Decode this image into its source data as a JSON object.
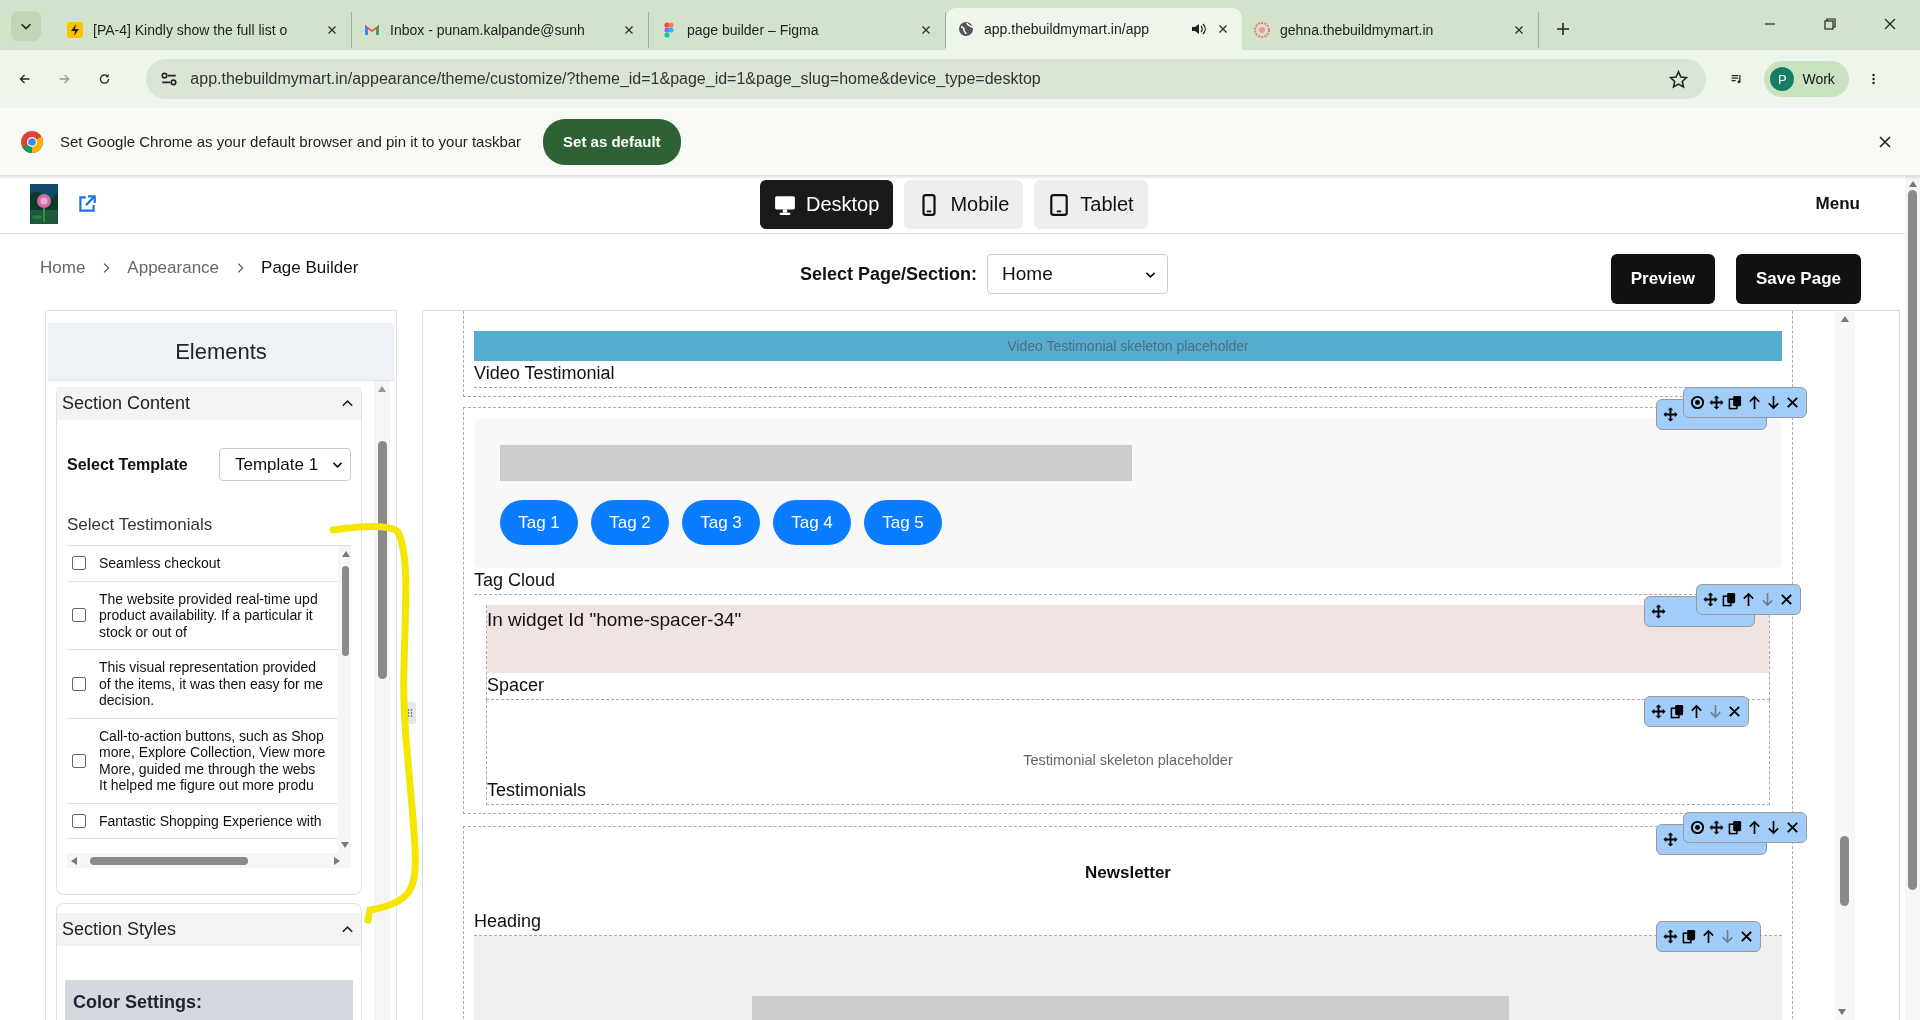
{
  "browser": {
    "tabs": [
      {
        "title": "[PA-4] Kindly show the full list o",
        "selected": false,
        "audio": false
      },
      {
        "title": "Inbox - punam.kalpande@sunh",
        "selected": false,
        "audio": false
      },
      {
        "title": "page builder – Figma",
        "selected": false,
        "audio": false
      },
      {
        "title": "app.thebuildmymart.in/app",
        "selected": true,
        "audio": true
      },
      {
        "title": "gehna.thebuildmymart.in",
        "selected": false,
        "audio": false
      }
    ],
    "address": "app.thebuildmymart.in/appearance/theme/customize/?theme_id=1&page_id=1&page_slug=home&device_type=desktop",
    "profile": {
      "initial": "P",
      "label": "Work"
    }
  },
  "infobar": {
    "message": "Set Google Chrome as your default browser and pin it to your taskbar",
    "button": "Set as default"
  },
  "header": {
    "devices": [
      {
        "label": "Desktop",
        "selected": true
      },
      {
        "label": "Mobile",
        "selected": false
      },
      {
        "label": "Tablet",
        "selected": false
      }
    ],
    "menu": "Menu"
  },
  "breadcrumb": [
    "Home",
    "Appearance",
    "Page Builder"
  ],
  "page_select": {
    "label": "Select Page/Section:",
    "value": "Home"
  },
  "actions": [
    "Preview",
    "Save Page"
  ],
  "elements_panel": {
    "title": "Elements",
    "section_content": {
      "title": "Section Content",
      "expanded": true,
      "template_label": "Select Template",
      "template_value": "Template 1",
      "testimonials_label": "Select Testimonials",
      "testimonials": [
        {
          "lines": [
            "Seamless checkout"
          ],
          "checked": false
        },
        {
          "lines": [
            "The website provided real-time upd",
            "product availability. If a particular it",
            "stock or out of"
          ],
          "checked": false
        },
        {
          "lines": [
            "This visual representation provided",
            "of the items, it was then easy for me",
            "decision."
          ],
          "checked": false
        },
        {
          "lines": [
            "Call-to-action buttons, such as Shop",
            "more, Explore Collection, View more",
            "More, guided me through the webs",
            "It helped me figure out more produ"
          ],
          "checked": false
        },
        {
          "lines": [
            "Fantastic Shopping Experience with"
          ],
          "checked": false
        }
      ]
    },
    "section_styles": {
      "title": "Section Styles",
      "expanded": true,
      "color_settings": "Color Settings:"
    }
  },
  "canvas": {
    "video_placeholder": "Video Testimonial skeleton placeholder",
    "video_label": "Video Testimonial",
    "tags": [
      "Tag 1",
      "Tag 2",
      "Tag 3",
      "Tag 4",
      "Tag 5"
    ],
    "tag_cloud_label": "Tag Cloud",
    "spacer_note": "In widget Id \"home-spacer-34\"",
    "spacer_label": "Spacer",
    "testimonial_placeholder": "Testimonial skeleton placeholder",
    "testimonials_label": "Testimonials",
    "newsletter_heading": "Newsletter",
    "heading_label": "Heading",
    "toolbars": [
      {
        "kind": "covered"
      },
      {
        "kind": "full",
        "eye": true,
        "down_disabled": false
      },
      {
        "kind": "covered"
      },
      {
        "kind": "full",
        "eye": false,
        "down_disabled": true
      },
      {
        "kind": "full",
        "eye": false,
        "down_disabled": true
      },
      {
        "kind": "covered"
      },
      {
        "kind": "full",
        "eye": true,
        "down_disabled": false
      },
      {
        "kind": "full",
        "eye": false,
        "down_disabled": true
      }
    ]
  }
}
